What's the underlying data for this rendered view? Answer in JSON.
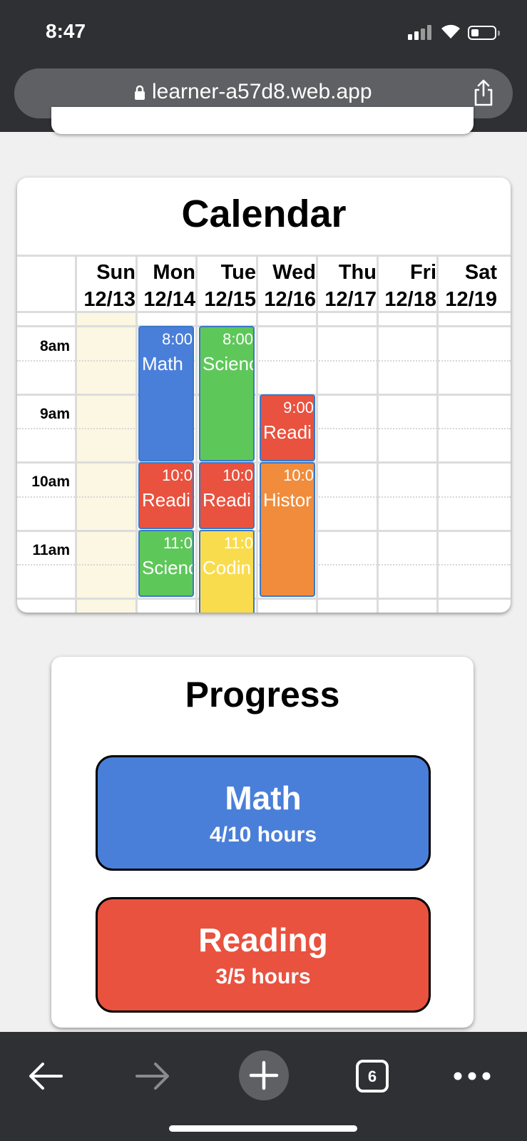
{
  "status_bar": {
    "time": "8:47"
  },
  "browser": {
    "url": "learner-a57d8.web.app",
    "tab_count": "6"
  },
  "calendar": {
    "title": "Calendar",
    "days": [
      {
        "name": "Sun",
        "date": "12/13"
      },
      {
        "name": "Mon",
        "date": "12/14"
      },
      {
        "name": "Tue",
        "date": "12/15"
      },
      {
        "name": "Wed",
        "date": "12/16"
      },
      {
        "name": "Thu",
        "date": "12/17"
      },
      {
        "name": "Fri",
        "date": "12/18"
      },
      {
        "name": "Sat",
        "date": "12/19"
      }
    ],
    "hours": [
      "8am",
      "9am",
      "10am",
      "11am"
    ],
    "events": [
      {
        "day": "Mon",
        "time": "8:00",
        "title": "Math",
        "color": "#4a7fd9"
      },
      {
        "day": "Mon",
        "time": "10:0",
        "title": "Readi",
        "color": "#e8523f"
      },
      {
        "day": "Mon",
        "time": "11:0",
        "title": "Scienc",
        "color": "#5ec75a"
      },
      {
        "day": "Tue",
        "time": "8:00",
        "title": "Scienc",
        "color": "#5ec75a"
      },
      {
        "day": "Tue",
        "time": "10:0",
        "title": "Readi",
        "color": "#e8523f"
      },
      {
        "day": "Tue",
        "time": "11:0",
        "title": "Codin",
        "color": "#f9dc4e"
      },
      {
        "day": "Wed",
        "time": "9:00",
        "title": "Readi",
        "color": "#e8523f"
      },
      {
        "day": "Wed",
        "time": "10:0",
        "title": "Histor",
        "color": "#f08c3c"
      }
    ]
  },
  "progress": {
    "title": "Progress",
    "items": [
      {
        "subject": "Math",
        "hours": "4/10 hours",
        "color": "#4a7fd9"
      },
      {
        "subject": "Reading",
        "hours": "3/5 hours",
        "color": "#e8523f"
      }
    ]
  },
  "icons": {
    "back": "arrow-left-icon",
    "forward": "arrow-right-icon",
    "new_tab": "plus-icon",
    "tabs": "tabs-icon",
    "menu": "more-icon",
    "share": "share-icon",
    "lock": "lock-icon"
  }
}
